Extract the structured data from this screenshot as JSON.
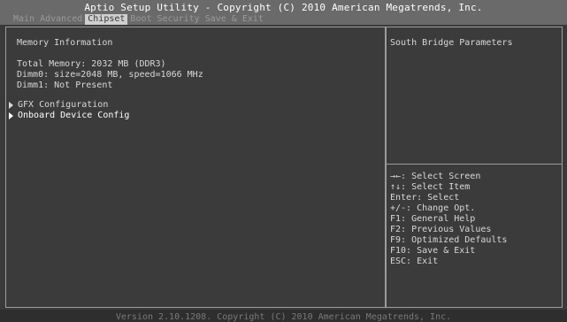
{
  "header": {
    "title": "Aptio Setup Utility - Copyright (C) 2010 American Megatrends, Inc.",
    "tabs": [
      {
        "label": "Main",
        "active": false
      },
      {
        "label": "Advanced",
        "active": false
      },
      {
        "label": "Chipset",
        "active": true
      },
      {
        "label": "Boot",
        "active": false
      },
      {
        "label": "Security",
        "active": false
      },
      {
        "label": "Save & Exit",
        "active": false
      }
    ]
  },
  "main": {
    "section_title": "Memory Information",
    "info_lines": [
      "Total Memory: 2032 MB (DDR3)",
      "Dimm0: size=2048 MB, speed=1066 MHz",
      "Dimm1: Not Present"
    ],
    "menu_items": [
      {
        "label": "GFX Configuration",
        "selected": false
      },
      {
        "label": "Onboard Device Config",
        "selected": true
      }
    ]
  },
  "help": {
    "description": "South Bridge Parameters",
    "keys": [
      "→←: Select Screen",
      "↑↓: Select Item",
      "Enter: Select",
      "+/-: Change Opt.",
      "F1: General Help",
      "F2: Previous Values",
      "F9: Optimized Defaults",
      "F10: Save & Exit",
      "ESC: Exit"
    ]
  },
  "footer": {
    "text": "Version 2.10.1208. Copyright (C) 2010 American Megatrends, Inc."
  },
  "colors": {
    "background": "#3a3a3a",
    "header": "#6a6a6a",
    "active_tab": "#cfcfcf",
    "border": "#9c9c9c",
    "text": "#d8d8d8",
    "selected_text": "#ffffff"
  }
}
